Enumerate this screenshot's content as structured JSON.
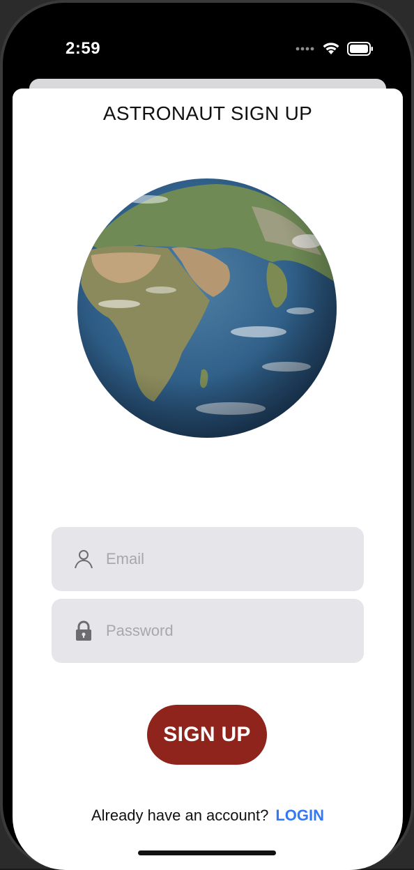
{
  "status_bar": {
    "time": "2:59"
  },
  "screen": {
    "title": "ASTRONAUT SIGN UP"
  },
  "form": {
    "email_placeholder": "Email",
    "password_placeholder": "Password",
    "signup_label": "SIGN UP"
  },
  "footer": {
    "prompt": "Already have an account?",
    "login_label": "LOGIN"
  },
  "icons": {
    "email": "person-icon",
    "password": "lock-icon",
    "signal": "signal-dots-icon",
    "wifi": "wifi-icon",
    "battery": "battery-icon"
  },
  "colors": {
    "signup_button": "#8e241b",
    "login_link": "#3478f6",
    "field_bg": "#e5e5ea"
  }
}
